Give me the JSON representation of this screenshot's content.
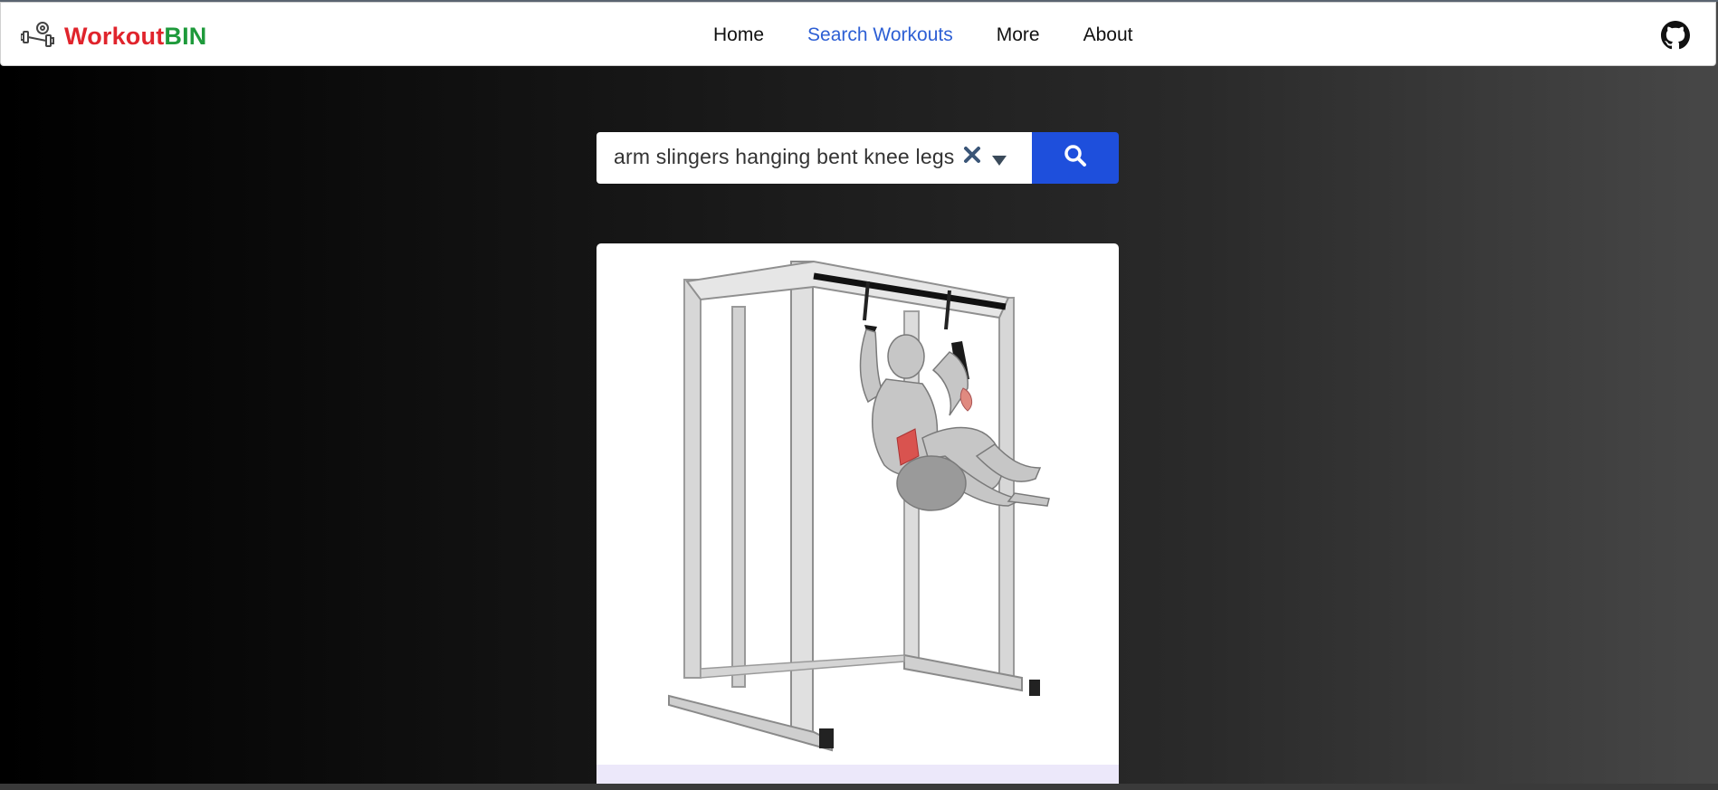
{
  "brand": {
    "part1": "Workout",
    "part2": "BIN",
    "logo_icon": "dumbbell-gear-icon"
  },
  "nav": {
    "items": [
      {
        "label": "Home",
        "active": false
      },
      {
        "label": "Search Workouts",
        "active": true
      },
      {
        "label": "More",
        "active": false
      },
      {
        "label": "About",
        "active": false
      }
    ],
    "github_icon": "github-icon"
  },
  "search": {
    "value": "arm slingers hanging bent knee legs",
    "clear_icon": "close-icon",
    "dropdown_icon": "caret-down-icon",
    "button_icon": "search-icon"
  },
  "result": {
    "image_subject": "hanging knee raise on pull-up frame illustration"
  },
  "colors": {
    "brand_red": "#e0242c",
    "brand_green": "#1e9a3b",
    "accent_blue": "#1e4fdc",
    "active_link": "#2d5fd4"
  }
}
